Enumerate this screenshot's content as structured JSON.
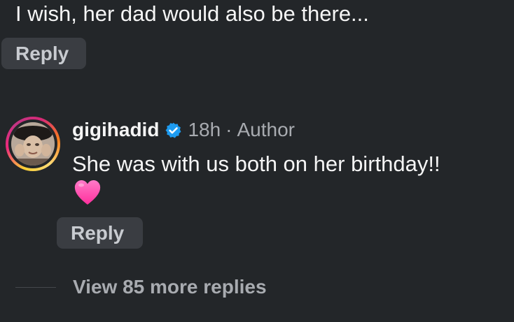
{
  "parent_comment": {
    "text": "I wish, her dad would also be there...",
    "reply_label": "Reply"
  },
  "reply_comment": {
    "username": "gigihadid",
    "verified": true,
    "time_ago": "18h",
    "separator": "·",
    "role": "Author",
    "text": "She was with us both on her birthday!!",
    "emoji": "pink-heart",
    "reply_label": "Reply"
  },
  "view_more_replies": "View 85 more replies",
  "colors": {
    "background": "#232629",
    "primary_text": "#f5f5f5",
    "secondary_text": "#a8abb0",
    "reply_button_bg": "#3a3d42",
    "verified_badge": "#1d9bf0",
    "heart": "#ff4fb4"
  }
}
